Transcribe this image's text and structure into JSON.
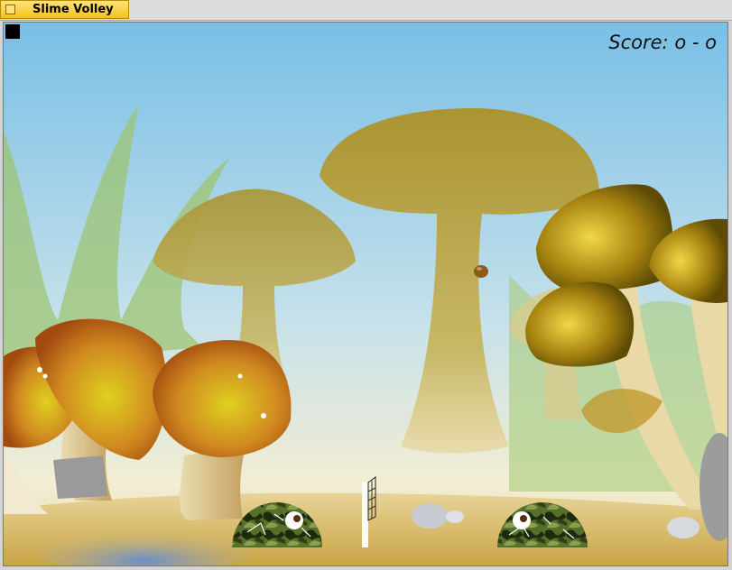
{
  "window": {
    "title": "Slime Volley"
  },
  "game": {
    "score_label": "Score:",
    "score_left": "o",
    "score_sep": "-",
    "score_right": "o"
  },
  "colors": {
    "sky_top": "#7cc1e6",
    "sky_bottom": "#f0ecd0",
    "ground": "#d7b962",
    "mushroom_silhouette": "#b39a3c",
    "camo_dark": "#1f2d12",
    "camo_green": "#5d7a2a",
    "ball": "#8a5a1e"
  },
  "icons": {
    "window_icon": "window-icon",
    "menu_button": "menu-square-icon"
  }
}
